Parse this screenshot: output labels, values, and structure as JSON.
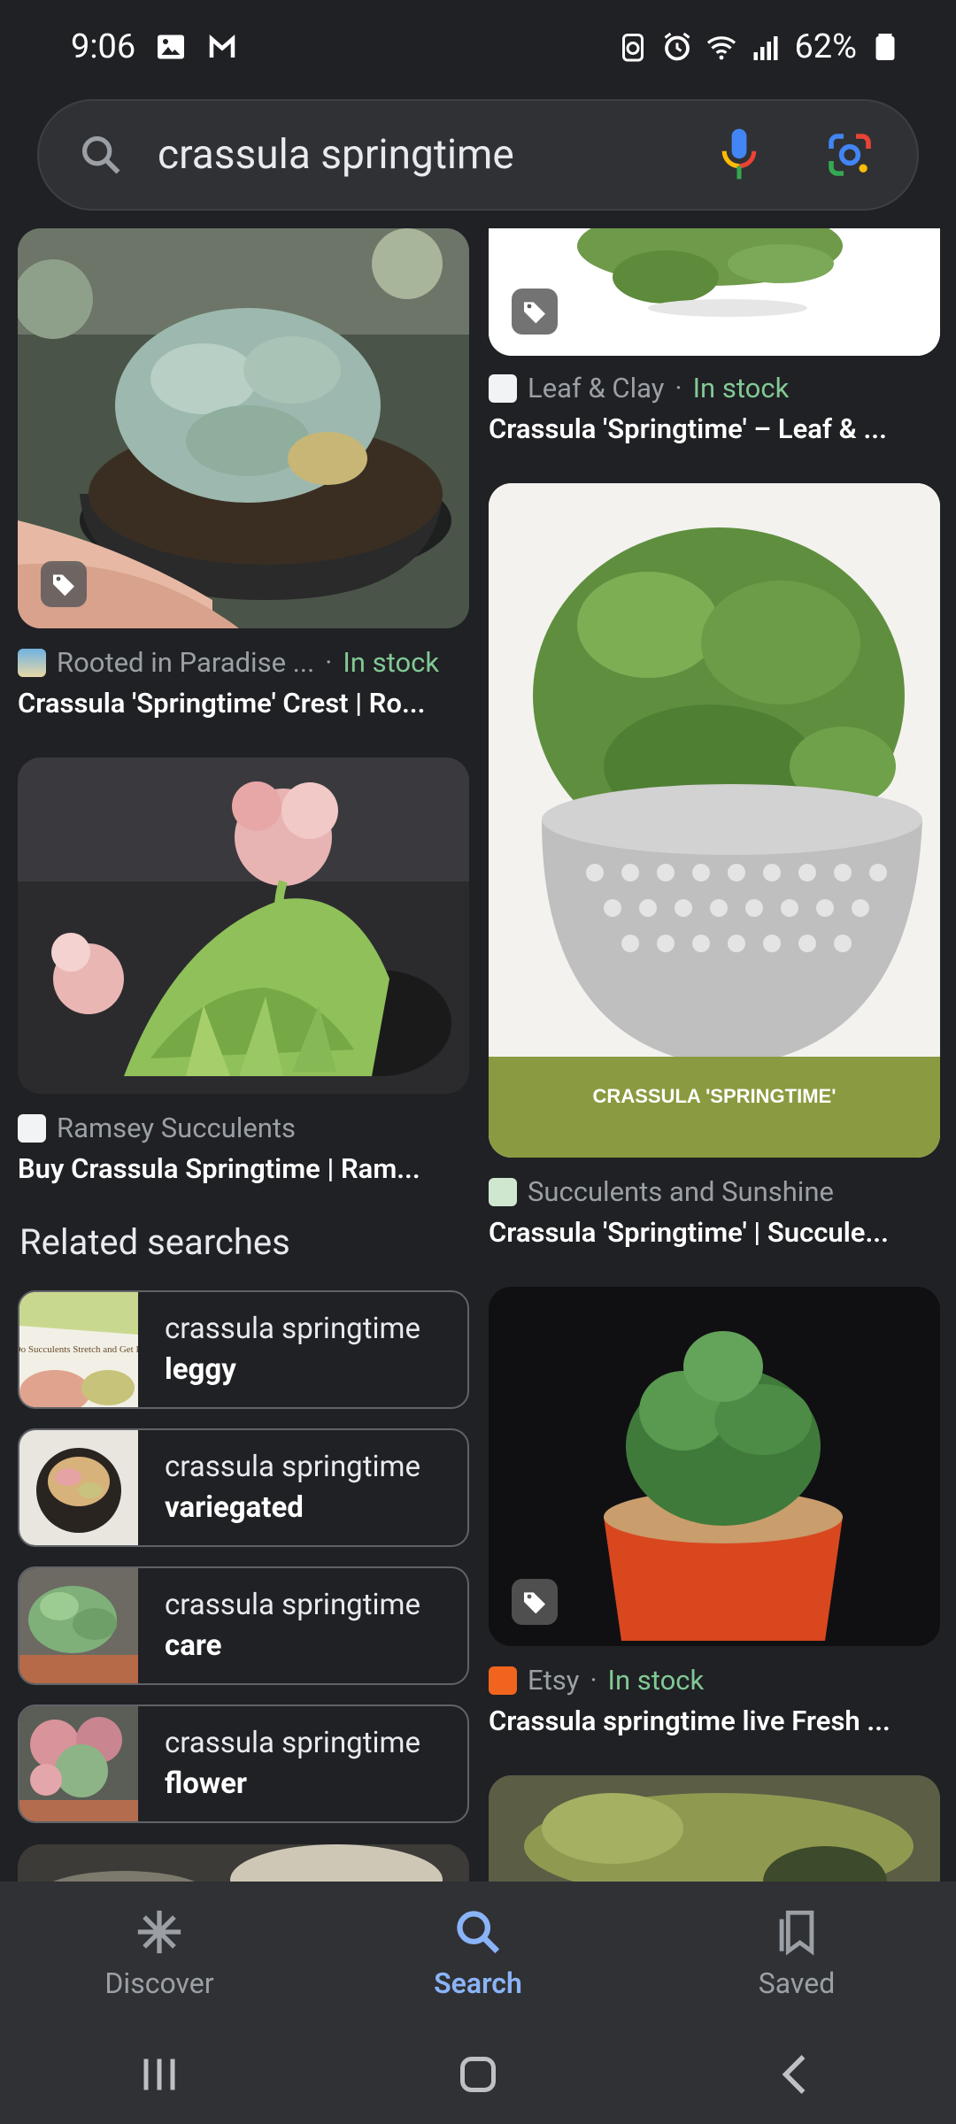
{
  "status": {
    "time": "9:06",
    "battery": "62%"
  },
  "search": {
    "query": "crassula springtime"
  },
  "results": {
    "left": [
      {
        "source": "Rooted in Paradise ...",
        "stock": "In stock",
        "title": "Crassula 'Springtime' Crest | Ro..."
      },
      {
        "source": "Ramsey Succulents",
        "stock": "",
        "title": "Buy Crassula Springtime | Ram..."
      }
    ],
    "right": [
      {
        "source": "Leaf & Clay",
        "stock": "In stock",
        "title": "Crassula 'Springtime' – Leaf & ..."
      },
      {
        "source": "Succulents and Sunshine",
        "stock": "",
        "title": "Crassula 'Springtime' | Succule...",
        "image_caption": "CRASSULA 'SPRINGTIME'"
      },
      {
        "source": "Etsy",
        "stock": "In stock",
        "title": "Crassula springtime live Fresh ..."
      }
    ]
  },
  "related": {
    "header": "Related searches",
    "items": [
      {
        "prefix": "crassula springtime",
        "suffix": "leggy",
        "thumb_text": "Why Do Succulents Stretch and Get Leggy?"
      },
      {
        "prefix": "crassula springtime",
        "suffix": "variegated"
      },
      {
        "prefix": "crassula springtime",
        "suffix": "care"
      },
      {
        "prefix": "crassula springtime",
        "suffix": "flower"
      }
    ]
  },
  "nav": {
    "discover": "Discover",
    "search": "Search",
    "saved": "Saved"
  },
  "colors": {
    "background": "#202124",
    "in_stock": "#81c995",
    "active_nav": "#8ab4f8"
  }
}
